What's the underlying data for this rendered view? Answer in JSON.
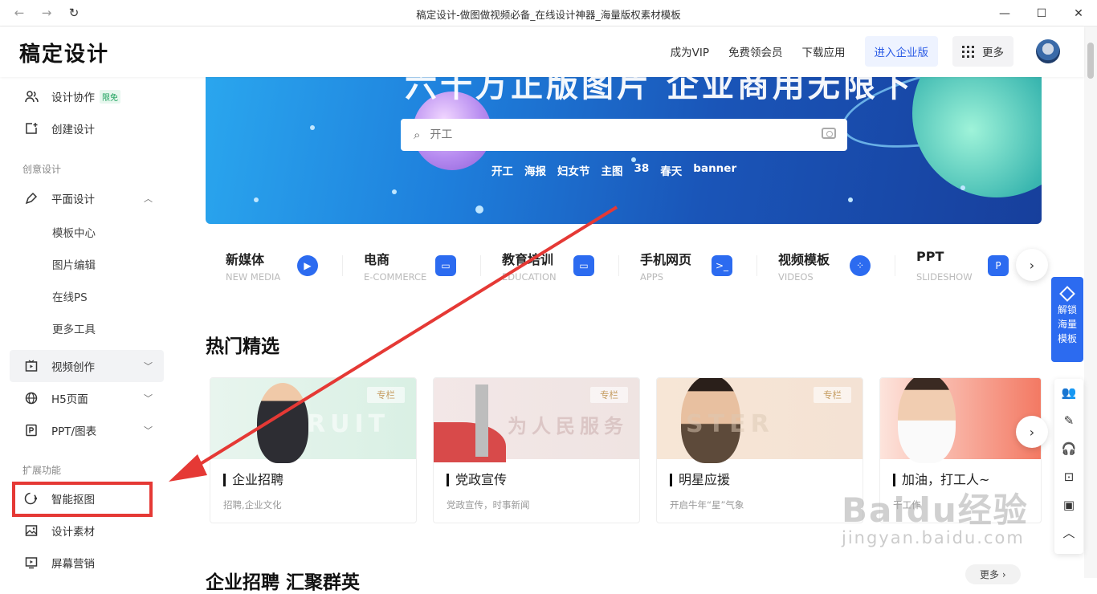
{
  "window": {
    "title": "稿定设计-做图做视频必备_在线设计神器_海量版权素材模板",
    "back_icon": "arrow-left",
    "forward_icon": "arrow-right",
    "reload_icon": "reload"
  },
  "header": {
    "logo": "稿定设计",
    "nav": [
      "成为VIP",
      "免费领会员",
      "下载应用"
    ],
    "enterprise": "进入企业版",
    "more": "更多"
  },
  "sidebar": {
    "collab": "设计协作",
    "collab_badge": "限免",
    "create": "创建设计",
    "section_creative": "创意设计",
    "flat_design": "平面设计",
    "sub_items": [
      "模板中心",
      "图片编辑",
      "在线PS",
      "更多工具"
    ],
    "video": "视频创作",
    "h5": "H5页面",
    "ppt": "PPT/图表",
    "section_ext": "扩展功能",
    "cutout": "智能抠图",
    "material": "设计素材",
    "screen": "屏幕营销"
  },
  "banner": {
    "headline": "六十万正版图片 企业商用无限下",
    "search_placeholder": "开工",
    "hot_words": [
      "开工",
      "海报",
      "妇女节",
      "主图",
      "38",
      "春天",
      "banner"
    ]
  },
  "categories": [
    {
      "title": "新媒体",
      "sub": "NEW MEDIA",
      "icon": "▶"
    },
    {
      "title": "电商",
      "sub": "E-COMMERCE",
      "icon": "▭"
    },
    {
      "title": "教育培训",
      "sub": "EDUCATION",
      "icon": "▭"
    },
    {
      "title": "手机网页",
      "sub": "APPS",
      "icon": ">_"
    },
    {
      "title": "视频模板",
      "sub": "VIDEOS",
      "icon": "⁘"
    },
    {
      "title": "PPT",
      "sub": "SLIDESHOW",
      "icon": "P"
    }
  ],
  "hot": {
    "title": "热门精选",
    "cards": [
      {
        "tag": "专栏",
        "name": "企业招聘",
        "desc": "招聘,企业文化",
        "watermark": "RUIT"
      },
      {
        "tag": "专栏",
        "name": "党政宣传",
        "desc": "党政宣传，时事新闻",
        "watermark": "为人民服务"
      },
      {
        "tag": "专栏",
        "name": "明星应援",
        "desc": "开启牛年“星”气象",
        "watermark": "STER"
      },
      {
        "tag": "",
        "name": "加油，打工人~",
        "desc": "干工作",
        "watermark": ""
      }
    ]
  },
  "next_section": "企业招聘 汇聚群英",
  "more_link": "更多 ›",
  "unlock": [
    "解锁",
    "海量",
    "模板"
  ],
  "watermark": {
    "brand": "Baidu经验",
    "url": "jingyan.baidu.com"
  },
  "colors": {
    "accent": "#2c6bf0",
    "highlight": "#e53935"
  }
}
